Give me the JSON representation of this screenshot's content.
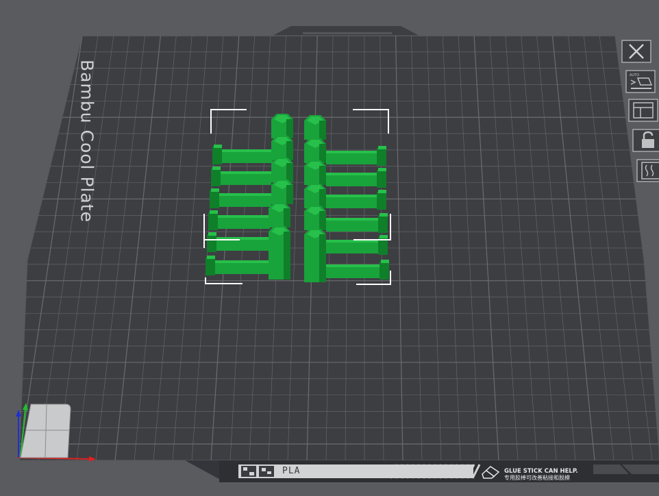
{
  "plate": {
    "name": "Bambu Cool Plate",
    "filament": "PLA",
    "hint_en": "GLUE STICK CAN HELP.",
    "hint_cn": "专用胶棒可改善粘接和脱模"
  },
  "colors": {
    "background": "#5a5b5f",
    "plate": "#3d3e42",
    "grid": "#6b6c70",
    "model": "#19a33b",
    "selection": "#ffffff",
    "axis_x": "#e02020",
    "axis_y": "#1fbf2f",
    "axis_z": "#1f2fd0"
  },
  "toolbar": {
    "items": [
      {
        "icon": "close-icon"
      },
      {
        "icon": "auto-arrange-icon"
      },
      {
        "icon": "layout-icon"
      },
      {
        "icon": "lock-icon"
      },
      {
        "icon": "plate-settings-icon"
      }
    ]
  }
}
